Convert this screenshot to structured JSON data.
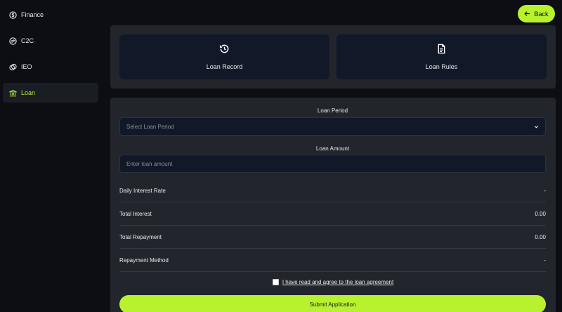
{
  "sidebar": {
    "items": [
      {
        "label": "Finance",
        "icon": "dollar-circle-icon"
      },
      {
        "label": "C2C",
        "icon": "exchange-circle-icon"
      },
      {
        "label": "IEO",
        "icon": "coins-icon"
      },
      {
        "label": "Loan",
        "icon": "bank-icon",
        "active": true
      }
    ]
  },
  "header": {
    "back_label": "Back"
  },
  "cards": {
    "loan_record": {
      "label": "Loan Record",
      "icon": "history-icon"
    },
    "loan_rules": {
      "label": "Loan Rules",
      "icon": "document-icon"
    }
  },
  "form": {
    "period_label": "Loan Period",
    "period_placeholder": "Select Loan Period",
    "amount_label": "Loan Amount",
    "amount_placeholder": "Enter loan amount",
    "rows": [
      {
        "label": "Daily Interest Rate",
        "value": "-"
      },
      {
        "label": "Total Interest",
        "value": "0.00"
      },
      {
        "label": "Total Repayment",
        "value": "0.00"
      },
      {
        "label": "Repayment Method",
        "value": "-"
      }
    ],
    "agree_text": "I have read and agree to the loan agreement",
    "submit_label": "Submit Application"
  },
  "colors": {
    "accent": "#b8f22f",
    "background": "#0c0e13",
    "panel": "#22252c",
    "card": "#111827"
  }
}
